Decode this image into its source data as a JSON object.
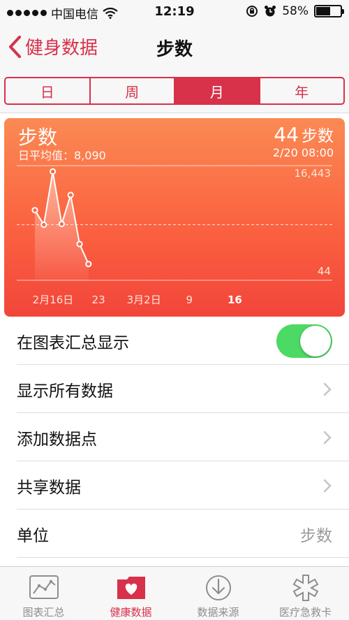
{
  "status_bar": {
    "carrier": "中国电信",
    "time": "12:19",
    "battery": "58%",
    "battery_level": 0.58
  },
  "nav": {
    "back_label": "健身数据",
    "title": "步数"
  },
  "segments": [
    {
      "label": "日",
      "active": false
    },
    {
      "label": "周",
      "active": false
    },
    {
      "label": "月",
      "active": true
    },
    {
      "label": "年",
      "active": false
    }
  ],
  "card": {
    "metric": "步数",
    "average_label": "日平均值：8,090",
    "count": "44",
    "count_unit": "步数",
    "date": "2/20 08:00",
    "max_label": "16,443",
    "min_label": "44"
  },
  "chart_data": {
    "type": "line",
    "y_max": 16443,
    "y_min": 44,
    "average": 8090,
    "x_ticks": [
      {
        "label": "2月16日",
        "day": 0
      },
      {
        "label": "23",
        "day": 7
      },
      {
        "label": "3月2日",
        "day": 14
      },
      {
        "label": "9",
        "day": 21
      },
      {
        "label": "16",
        "day": 28,
        "bold": true
      }
    ],
    "points": [
      {
        "day": 0,
        "value": 10200
      },
      {
        "day": 1,
        "value": 8090
      },
      {
        "day": 2,
        "value": 15800
      },
      {
        "day": 3,
        "value": 8200
      },
      {
        "day": 4,
        "value": 12400
      },
      {
        "day": 5,
        "value": 5300
      },
      {
        "day": 6,
        "value": 2400
      }
    ]
  },
  "list": {
    "show_on_dashboard": "在图表汇总显示",
    "show_all_data": "显示所有数据",
    "add_data_point": "添加数据点",
    "share_data": "共享数据",
    "unit_label": "单位",
    "unit_value": "步数"
  },
  "tabs": [
    {
      "label": "图表汇总",
      "icon": "dashboard-icon",
      "active": false
    },
    {
      "label": "健康数据",
      "icon": "health-data-icon",
      "active": true
    },
    {
      "label": "数据来源",
      "icon": "sources-icon",
      "active": false
    },
    {
      "label": "医疗急救卡",
      "icon": "medical-id-icon",
      "active": false
    }
  ],
  "colors": {
    "accent": "#d8314a",
    "toggle_on": "#4cd964",
    "card_top": "#fb8a54",
    "card_bottom": "#f2453b"
  }
}
